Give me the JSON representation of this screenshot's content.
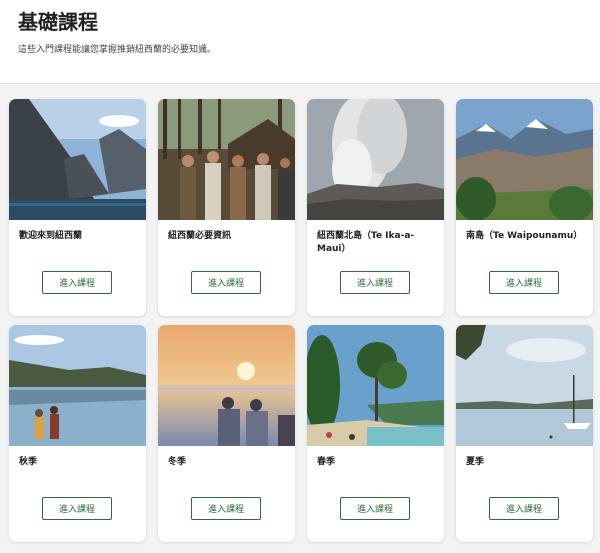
{
  "header": {
    "title": "基礎課程",
    "subtitle": "這些入門課程能讓您掌握推銷紐西蘭的必要知識。"
  },
  "cards": [
    {
      "title": "歡迎來到紐西蘭",
      "button": "進入課程",
      "image": "fiord-mountains-photo"
    },
    {
      "title": "紐西蘭必要資訊",
      "button": "進入課程",
      "image": "maori-group-photo"
    },
    {
      "title": "紐西蘭北島（Te Ika-a-Maui）",
      "button": "進入課程",
      "image": "geyser-photo"
    },
    {
      "title": "南島（Te Waipounamu）",
      "button": "進入課程",
      "image": "snow-mountains-photo"
    },
    {
      "title": "秋季",
      "button": "進入課程",
      "image": "lake-hikers-photo"
    },
    {
      "title": "冬季",
      "button": "進入課程",
      "image": "sunset-hikers-photo"
    },
    {
      "title": "春季",
      "button": "進入課程",
      "image": "beach-trees-photo"
    },
    {
      "title": "夏季",
      "button": "進入課程",
      "image": "sailboat-bay-photo"
    }
  ],
  "colors": {
    "accent": "#2f6b3a",
    "page_background": "#f3f3f3"
  }
}
